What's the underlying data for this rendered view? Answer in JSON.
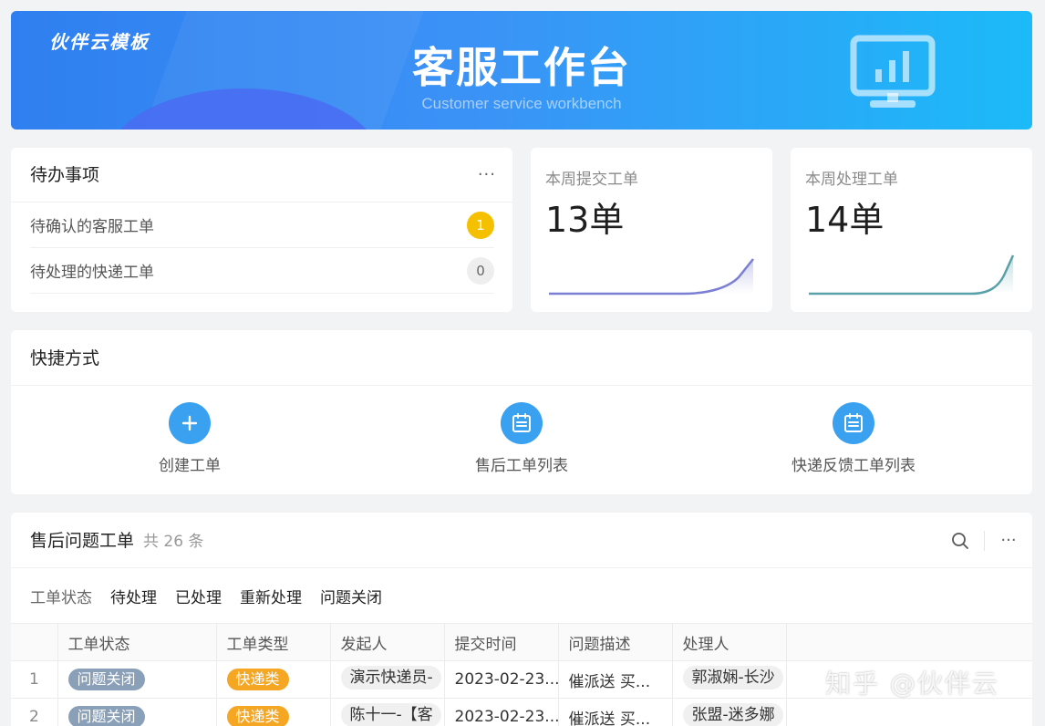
{
  "banner": {
    "brand": "伙伴云模板",
    "title": "客服工作台",
    "subtitle": "Customer service workbench"
  },
  "todo": {
    "title": "待办事项",
    "more": "···",
    "items": [
      {
        "label": "待确认的客服工单",
        "count": "1"
      },
      {
        "label": "待处理的快递工单",
        "count": "0"
      }
    ]
  },
  "stats": [
    {
      "label": "本周提交工单",
      "value": "13单"
    },
    {
      "label": "本周处理工单",
      "value": "14单"
    }
  ],
  "quick": {
    "title": "快捷方式",
    "items": [
      {
        "label": "创建工单",
        "icon": "plus-icon"
      },
      {
        "label": "售后工单列表",
        "icon": "calendar-list-icon"
      },
      {
        "label": "快递反馈工单列表",
        "icon": "calendar-list-icon"
      }
    ]
  },
  "tickets": {
    "title": "售后问题工单",
    "count": "共 26 条",
    "more": "···",
    "filter_label": "工单状态",
    "filters": [
      "待处理",
      "已处理",
      "重新处理",
      "问题关闭"
    ],
    "columns": [
      "工单状态",
      "工单类型",
      "发起人",
      "提交时间",
      "问题描述",
      "处理人"
    ],
    "rows": [
      {
        "index": "1",
        "status": "问题关闭",
        "type": "快递类",
        "initiator": "演示快递员-",
        "time": "2023-02-23...",
        "desc": "催派送 买...",
        "handler": "郭淑娴-长沙"
      },
      {
        "index": "2",
        "status": "问题关闭",
        "type": "快递类",
        "initiator": "陈十一-【客",
        "time": "2023-02-23...",
        "desc": "催派送 买...",
        "handler": "张盟-迷多娜"
      }
    ]
  },
  "watermark": "知乎 @伙伴云",
  "colors": {
    "banner_start": "#2f7ff0",
    "banner_end": "#1cbaf8",
    "accent_blue": "#3aa0f0",
    "badge_yellow": "#f5c000",
    "tag_closed": "#8a9fb8",
    "tag_express": "#f5a623",
    "spark1": "#7b7fd4",
    "spark2": "#5aa0a8"
  }
}
